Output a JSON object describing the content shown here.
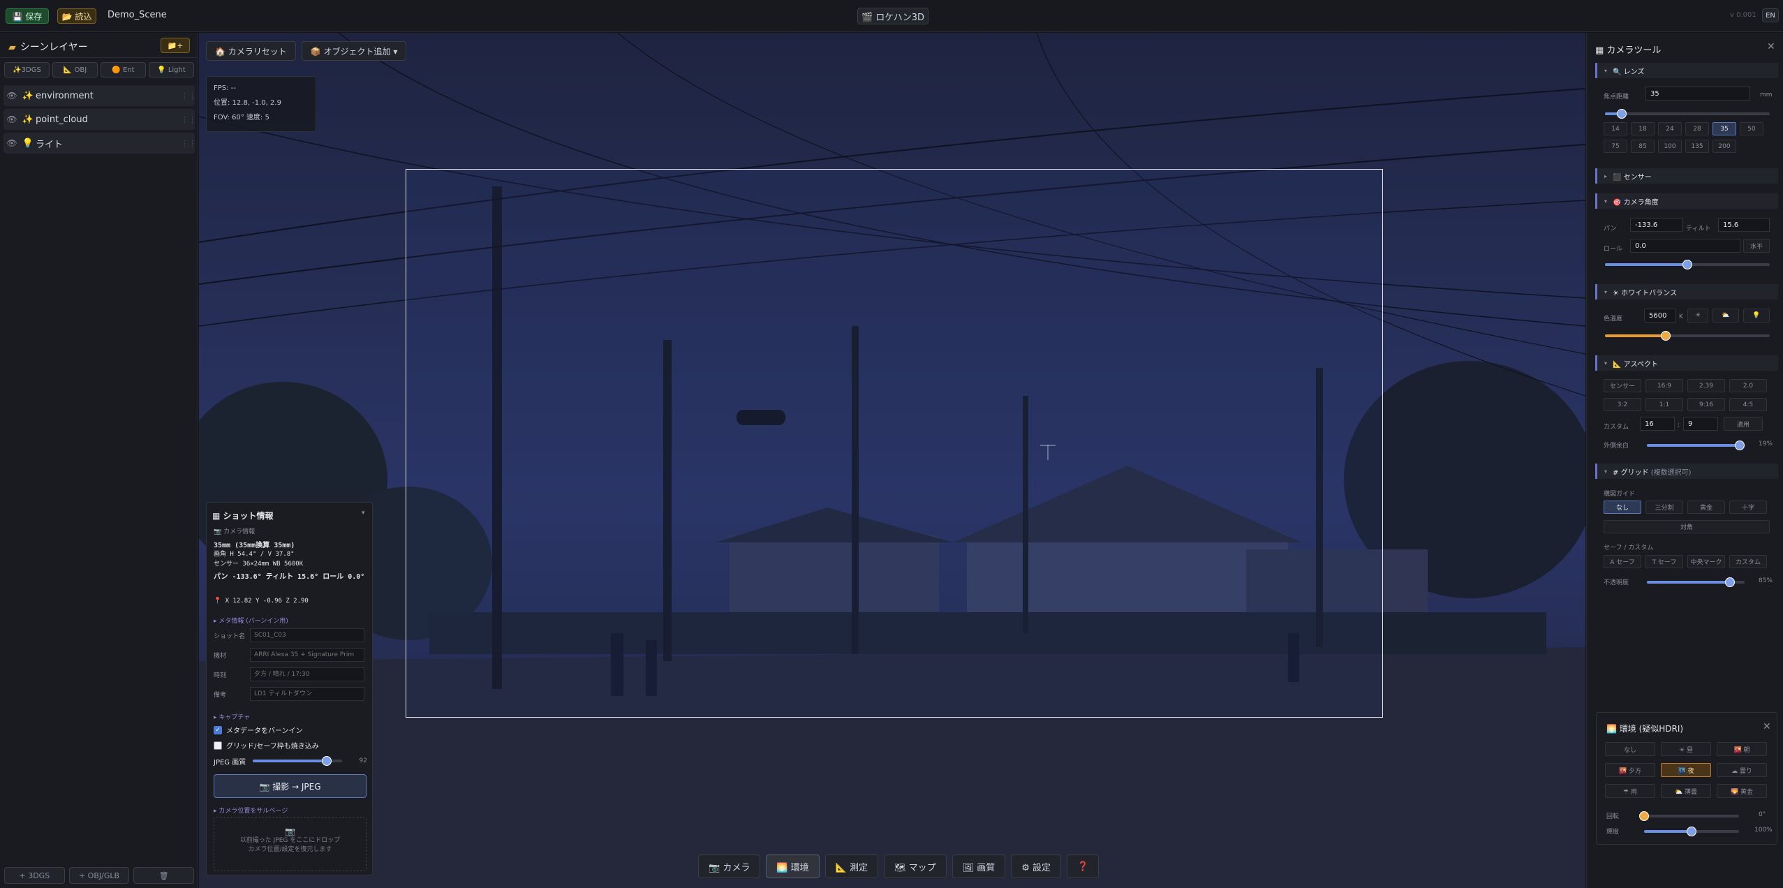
{
  "topbar": {
    "save": "💾 保存",
    "load": "📂 読込",
    "scene_name": "Demo_Scene",
    "app_title": "🎬 ロケハン3D",
    "version": "v 0.001",
    "lang": "EN"
  },
  "left": {
    "title": "シーンレイヤー",
    "add": "📁+",
    "filters": [
      "✨3DGS",
      "📐 OBJ",
      "🟠 Ent",
      "💡 Light"
    ],
    "layers": [
      {
        "icon": "✨",
        "name": "environment"
      },
      {
        "icon": "✨",
        "name": "point_cloud"
      },
      {
        "icon": "💡",
        "name": "ライト"
      }
    ],
    "footer": [
      "+ 3DGS",
      "+ OBJ/GLB",
      "🗑"
    ]
  },
  "viewport": {
    "tools": [
      "🏠 カメラリセット",
      "📦 オブジェクト追加 ▾"
    ],
    "fps": "FPS: --",
    "position": "位置: 12.8, -1.0, 2.9",
    "fov": "FOV: 60°  速度: 5",
    "bottom_tabs": [
      "📷 カメラ",
      "🌅 環境",
      "📐 測定",
      "🗺 マップ",
      "🖼 画質",
      "⚙ 設定",
      "❓"
    ]
  },
  "shot": {
    "title": "ショット情報",
    "toggle": "▾",
    "cam_header": "📷 カメラ情報",
    "lens_line": "35mm (35mm換算 35mm)",
    "angle_line": "画角 H 54.4° / V 37.8°",
    "sensor_line": "センサー 36×24mm  WB 5600K",
    "pan_line": "パン -133.6°  ティルト 15.6°  ロール 0.0°",
    "pos_line": "📍 X 12.82  Y -0.96  Z 2.90",
    "meta_header": "▸ メタ情報 (バーンイン用)",
    "fields": [
      {
        "label": "ショット名",
        "placeholder": "SC01_C03"
      },
      {
        "label": "機材",
        "placeholder": "ARRI Alexa 35 + Signature Prim"
      },
      {
        "label": "時刻",
        "placeholder": "夕方 / 晴れ / 17:30"
      },
      {
        "label": "備考",
        "placeholder": "LD1 ティルトダウン"
      }
    ],
    "capture_header": "▸ キャプチャ",
    "burnin": "メタデータをバーンイン",
    "grid_burn": "グリッド/セーフ枠も焼き込み",
    "jpeg_label": "JPEG 画質",
    "jpeg_value": "92",
    "jpeg_quality": 92,
    "capture_btn": "📷 撮影 → JPEG",
    "survey_header": "▸ カメラ位置をサルベージ",
    "drop_icon": "📷",
    "drop_line1": "以前撮った JPEG をここにドロップ",
    "drop_line2": "カメラ位置/設定を復元します"
  },
  "right": {
    "title": "カメラツール",
    "lens": {
      "header": "🔍 レンズ",
      "focal_label": "焦点距離",
      "focal_value": "35",
      "unit": "mm",
      "focal_fraction": 0.1,
      "presets": [
        "14",
        "18",
        "24",
        "28",
        "35",
        "50",
        "75",
        "85",
        "100",
        "135",
        "200"
      ],
      "active": "35"
    },
    "sensor_header": "⬛ センサー",
    "angle": {
      "header": "🎯 カメラ角度",
      "pan_label": "パン",
      "pan": "-133.6",
      "tilt_label": "ティルト",
      "tilt": "15.6",
      "roll_label": "ロール",
      "roll": "0.0",
      "level_btn": "水平",
      "roll_fraction": 0.5
    },
    "wb": {
      "header": "☀ ホワイトバランス",
      "label": "色温度",
      "value": "5600",
      "unit": "K",
      "icons": [
        "☀",
        "⛅",
        "💡"
      ],
      "fraction": 0.37
    },
    "aspect": {
      "header": "📐 アスペクト",
      "options": [
        "センサー",
        "16:9",
        "2.39",
        "2.0",
        "3:2",
        "1:1",
        "9:16",
        "4:5"
      ],
      "custom_label": "カスタム",
      "custom_w": "16",
      "custom_h": "9",
      "apply": "適用",
      "margin_label": "外側余白",
      "margin_value": "19%",
      "margin_fraction": 0.95
    },
    "grid": {
      "header": "# グリッド",
      "header_note": "(複数選択可)",
      "guide_label": "構図ガイド",
      "guides": [
        "なし",
        "三分割",
        "黄金",
        "十字"
      ],
      "active_guide": "なし",
      "diagonal": "対角",
      "safe_label": "セーフ / カスタム",
      "safes": [
        "A セーフ",
        "T セーフ",
        "中央マーク",
        "カスタム"
      ],
      "opacity_label": "不透明度",
      "opacity_value": "85%",
      "opacity_fraction": 0.85
    }
  },
  "env": {
    "title": "🌅 環境 (疑似HDRI)",
    "presets": [
      "なし",
      "☀ 昼",
      "🌇 朝",
      "🌇 夕方",
      "🌃 夜",
      "☁ 曇り",
      "☂ 雨",
      "⛅ 薄曇",
      "🌄 黄金"
    ],
    "active": "🌃 夜",
    "rotation_label": "回転",
    "rotation_value": "0°",
    "rotation_fraction": 0.0,
    "brightness_label": "輝度",
    "brightness_value": "100%",
    "brightness_fraction": 0.5
  }
}
